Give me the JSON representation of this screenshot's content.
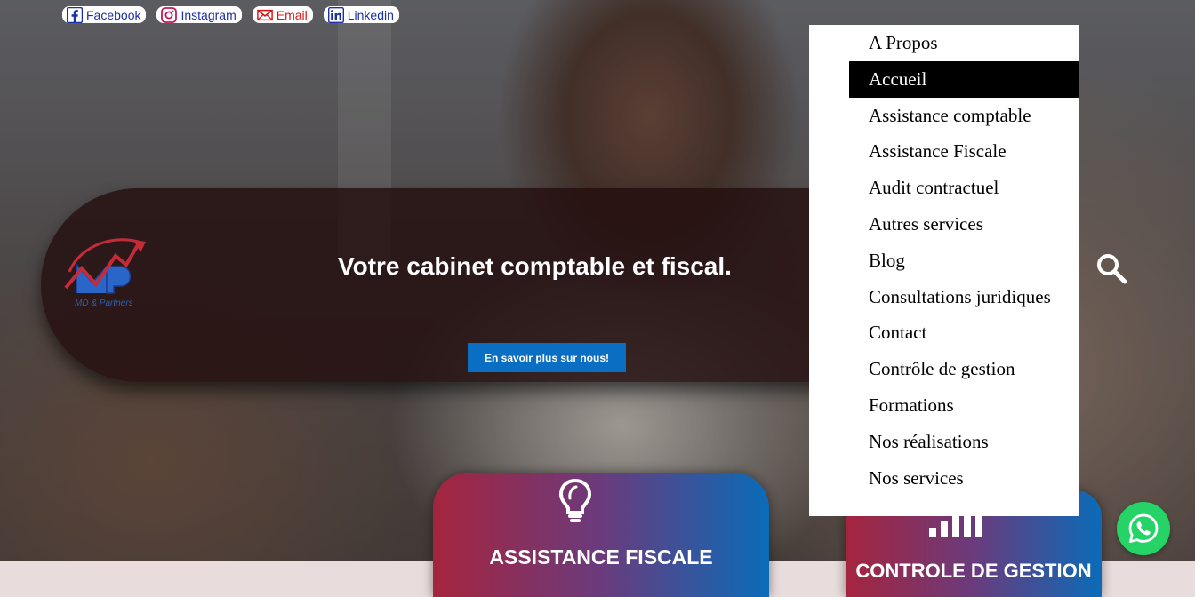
{
  "socials": [
    {
      "label": "Facebook",
      "icon": "facebook-icon"
    },
    {
      "label": "Instagram",
      "icon": "instagram-icon"
    },
    {
      "label": "Email",
      "icon": "email-icon"
    },
    {
      "label": "Linkedin",
      "icon": "linkedin-icon"
    }
  ],
  "banner": {
    "logo_text": "MD & Partners",
    "title": "Votre cabinet comptable et fiscal.",
    "cta_label": "En savoir plus sur nous!"
  },
  "menu": {
    "items": [
      "A Propos",
      "Accueil",
      "Assistance comptable",
      "Assistance Fiscale",
      "Audit contractuel",
      "Autres services",
      "Blog",
      "Consultations juridiques",
      "Contact",
      "Contrôle de gestion",
      "Formations",
      "Nos réalisations",
      "Nos services"
    ],
    "active": "Accueil"
  },
  "cards": [
    {
      "title": "ASSISTANCE FISCALE",
      "icon": "lightbulb-icon"
    },
    {
      "title": "CONTROLE DE GESTION",
      "icon": "bar-chart-icon"
    }
  ],
  "colors": {
    "accent_blue": "#0a6fc2",
    "accent_red": "#a5243e",
    "whatsapp_green": "#25d366"
  }
}
